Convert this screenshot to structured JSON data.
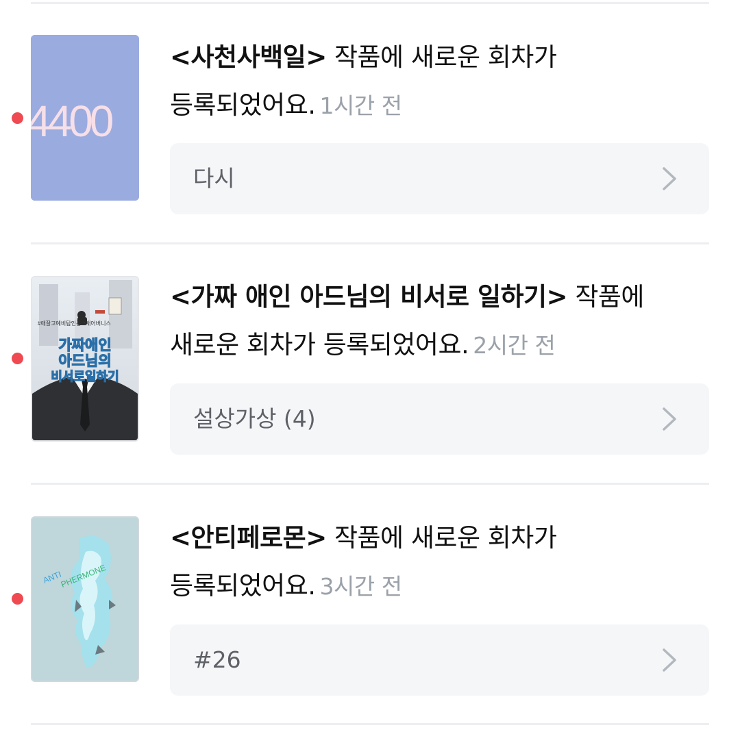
{
  "notifications": [
    {
      "title": "<사천사백일>",
      "message_first": " 작품에 새로운 회차가",
      "message_second": "등록되었어요.",
      "time": "1시간 전",
      "episode": "다시",
      "cover_text": "4400",
      "cover_bg": "#9aabe0",
      "unread": true
    },
    {
      "title": "<가짜 애인 아드님의 비서로 일하기>",
      "message_first": " 작품에",
      "message_second": "새로운 회차가 등록되었어요.",
      "time": "2시간 전",
      "episode": "설상가상 (4)",
      "cover_tag": "#애잘고예비탐인공 #새어버니스",
      "cover_title_1": "가짜애인",
      "cover_title_2": "아드님의",
      "cover_title_3": "비서로일하기",
      "unread": true
    },
    {
      "title": "<안티페로몬>",
      "message_first": " 작품에 새로운 회차가",
      "message_second": "등록되었어요.",
      "time": "3시간 전",
      "episode": "#26",
      "cover_text_1": "ANTI",
      "cover_text_2": "PHERMONE",
      "cover_bg": "#bfd6da",
      "unread": true
    }
  ],
  "colors": {
    "unread_dot": "#ef4a52",
    "time_text": "#9ba1a9",
    "episode_bg": "#f5f6f8"
  },
  "icons": {
    "chevron": "chevron-right-icon",
    "unread": "unread-dot"
  }
}
